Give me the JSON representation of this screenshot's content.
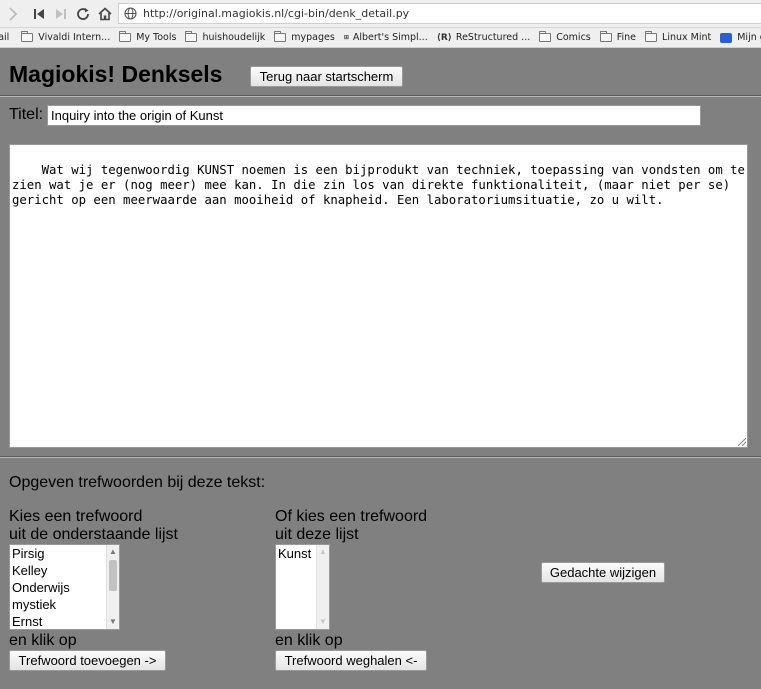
{
  "browser": {
    "url": "http://original.magiokis.nl/cgi-bin/denk_detail.py",
    "bookmarks": [
      {
        "label": "Mail",
        "icon": "mail-icon"
      },
      {
        "label": "Vivaldi Intern...",
        "icon": "folder-icon"
      },
      {
        "label": "My Tools",
        "icon": "folder-icon"
      },
      {
        "label": "huishoudelijk",
        "icon": "folder-icon"
      },
      {
        "label": "mypages",
        "icon": "folder-icon"
      },
      {
        "label": "Albert's Simpl...",
        "icon": "site-icon"
      },
      {
        "label": "ReStructured ...",
        "icon": "site-icon"
      },
      {
        "label": "Comics",
        "icon": "folder-icon"
      },
      {
        "label": "Fine",
        "icon": "folder-icon"
      },
      {
        "label": "Linux Mint",
        "icon": "folder-icon"
      },
      {
        "label": "Mijn groepe",
        "icon": "site-icon"
      }
    ]
  },
  "page": {
    "heading": "Magiokis! Denksels",
    "back_button": "Terug naar startscherm",
    "title_label": "Titel:",
    "title_value": "Inquiry into the origin of Kunst",
    "body_text": "Wat wij tegenwoordig KUNST noemen is een bijprodukt van techniek, toepassing van vondsten om te zien wat je er (nog meer) mee kan. In die zin los van direkte funktionaliteit, (maar niet per se) gericht op een meerwaarde aan mooiheid of knapheid. Een laboratoriumsituatie, zo u wilt.",
    "keywords_heading": "Opgeven trefwoorden bij deze tekst:",
    "left": {
      "caption_line1": "Kies een trefwoord",
      "caption_line2": "uit de onderstaande lijst",
      "options": [
        "Pirsig",
        "Kelley",
        "Onderwijs",
        "mystiek",
        "Ernst"
      ],
      "click_label": "en klik op",
      "button": "Trefwoord toevoegen ->"
    },
    "right": {
      "caption_line1": "Of kies een trefwoord",
      "caption_line2": "uit deze lijst",
      "options": [
        "Kunst"
      ],
      "click_label": "en klik op",
      "button": "Trefwoord weghalen <-"
    },
    "save_button": "Gedachte wijzigen"
  }
}
